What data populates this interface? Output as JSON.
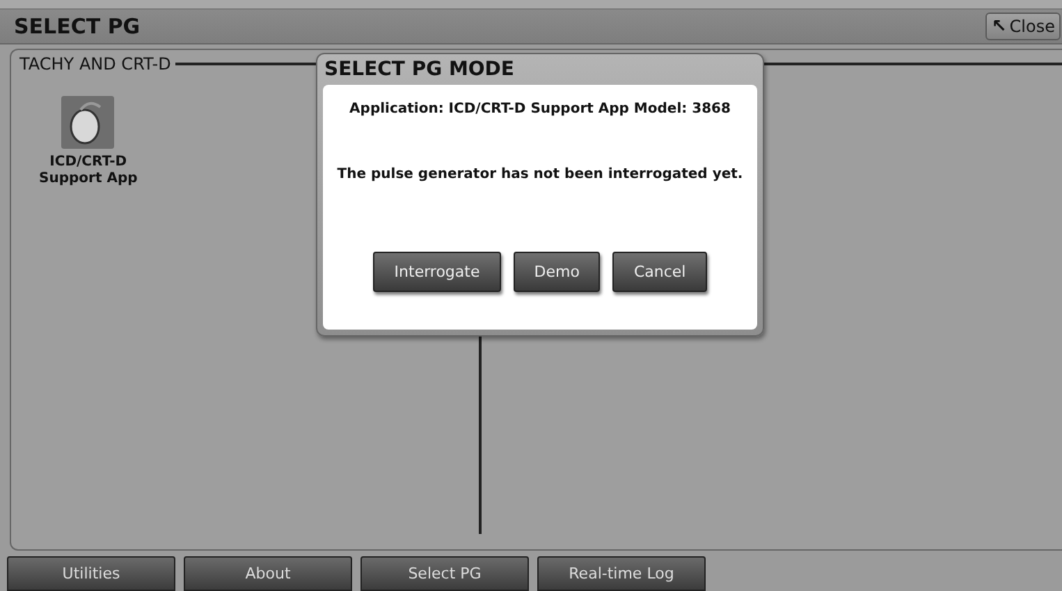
{
  "window": {
    "title": "SELECT PG",
    "close_button": {
      "icon": "↖",
      "label": "Close"
    }
  },
  "group": {
    "title": "TACHY AND CRT-D",
    "apps": [
      {
        "label_lines": [
          "ICD/CRT-D",
          "Support App"
        ]
      }
    ]
  },
  "dialog": {
    "title": "SELECT PG MODE",
    "messages": [
      "Application: ICD/CRT-D Support App Model: 3868",
      "The pulse generator has not been interrogated yet."
    ],
    "buttons": [
      "Interrogate",
      "Demo",
      "Cancel"
    ]
  },
  "nav_buttons": [
    "Utilities",
    "About",
    "Select PG",
    "Real-time Log"
  ]
}
